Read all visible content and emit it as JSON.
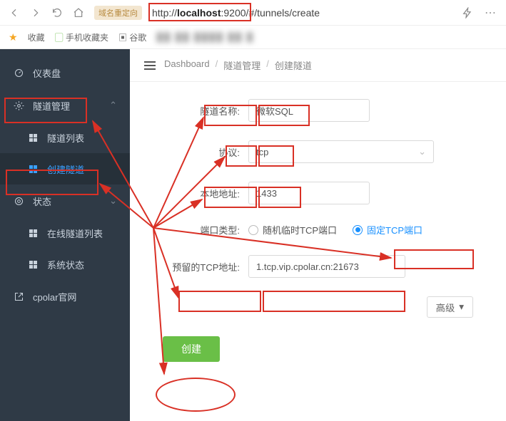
{
  "browser": {
    "redirect_label": "域名重定向",
    "url_prefix": "http://",
    "url_host": "localhost",
    "url_port": ":9200/",
    "url_path": "#/tunnels/create"
  },
  "bookmarks": {
    "fav": "收藏",
    "mobile": "手机收藏夹",
    "google": "谷歌"
  },
  "sidebar": {
    "dashboard": "仪表盘",
    "tunnel_mgmt": "隧道管理",
    "tunnel_list": "隧道列表",
    "tunnel_create": "创建隧道",
    "status": "状态",
    "online_list": "在线隧道列表",
    "sys_status": "系统状态",
    "official": "cpolar官网"
  },
  "breadcrumb": {
    "root": "Dashboard",
    "mid": "隧道管理",
    "leaf": "创建隧道"
  },
  "form": {
    "name_label": "隧道名称:",
    "name_value": "微软SQL",
    "proto_label": "协议:",
    "proto_value": "tcp",
    "addr_label": "本地地址:",
    "addr_value": "1433",
    "port_type_label": "端口类型:",
    "port_random": "随机临时TCP端口",
    "port_fixed": "固定TCP端口",
    "reserve_label": "预留的TCP地址:",
    "reserve_value": "1.tcp.vip.cpolar.cn:21673",
    "advanced": "高级",
    "submit": "创建"
  }
}
